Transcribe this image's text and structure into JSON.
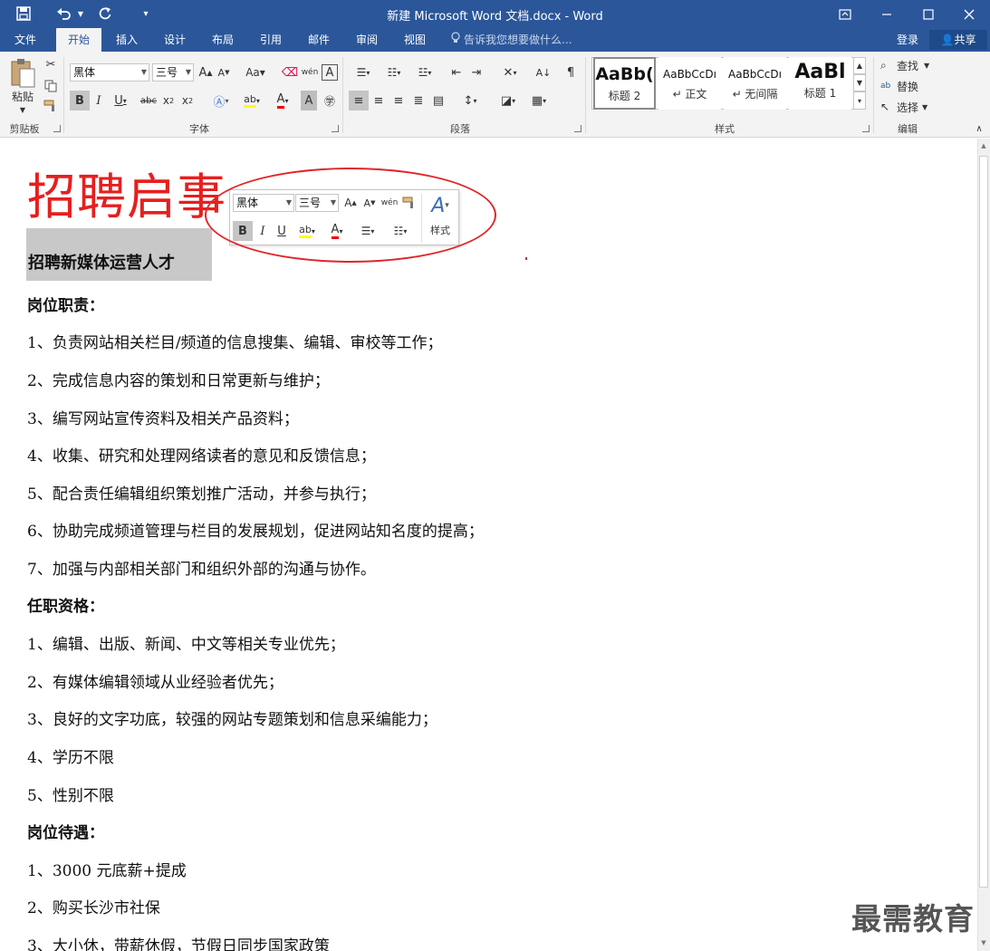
{
  "window": {
    "title": "新建 Microsoft Word 文档.docx - Word"
  },
  "quick_access": {
    "save_icon": "save-icon",
    "undo_icon": "undo-icon",
    "redo_icon": "redo-icon",
    "customize_icon": "customize-icon"
  },
  "tabs": [
    "文件",
    "开始",
    "插入",
    "设计",
    "布局",
    "引用",
    "邮件",
    "审阅",
    "视图"
  ],
  "tell_me": "告诉我您想要做什么...",
  "login": "登录",
  "share": "共享",
  "ribbon": {
    "groups": {
      "clipboard": "剪贴板",
      "font": "字体",
      "paragraph": "段落",
      "styles": "样式",
      "editing": "编辑"
    },
    "paste_label": "粘贴",
    "font_name": "黑体",
    "font_size": "三号",
    "styles": [
      {
        "preview": "AaBb(",
        "name": "标题 2"
      },
      {
        "preview": "AaBbCcDı",
        "name": "↵ 正文"
      },
      {
        "preview": "AaBbCcDı",
        "name": "↵ 无间隔"
      },
      {
        "preview": "AaBl",
        "name": "标题 1"
      }
    ],
    "find": "查找",
    "replace": "替换",
    "select": "选择"
  },
  "mini_toolbar": {
    "font_name": "黑体",
    "font_size": "三号",
    "styles_label": "样式"
  },
  "document": {
    "title": "招聘启事",
    "subtitle": "招聘新媒体运营人才",
    "lines": [
      {
        "text": "岗位职责：",
        "heading": true
      },
      {
        "text": "1、负责网站相关栏目/频道的信息搜集、编辑、审校等工作；",
        "heading": false
      },
      {
        "text": "2、完成信息内容的策划和日常更新与维护；",
        "heading": false
      },
      {
        "text": "3、编写网站宣传资料及相关产品资料；",
        "heading": false
      },
      {
        "text": "4、收集、研究和处理网络读者的意见和反馈信息；",
        "heading": false
      },
      {
        "text": "5、配合责任编辑组织策划推广活动，并参与执行；",
        "heading": false
      },
      {
        "text": "6、协助完成频道管理与栏目的发展规划，促进网站知名度的提高；",
        "heading": false
      },
      {
        "text": "7、加强与内部相关部门和组织外部的沟通与协作。",
        "heading": false
      },
      {
        "text": "任职资格：",
        "heading": true
      },
      {
        "text": "1、编辑、出版、新闻、中文等相关专业优先；",
        "heading": false
      },
      {
        "text": "2、有媒体编辑领域从业经验者优先；",
        "heading": false
      },
      {
        "text": "3、良好的文字功底，较强的网站专题策划和信息采编能力；",
        "heading": false
      },
      {
        "text": "4、学历不限",
        "heading": false
      },
      {
        "text": "5、性别不限",
        "heading": false
      },
      {
        "text": "岗位待遇：",
        "heading": true
      },
      {
        "text": "1、3000 元底薪+提成",
        "heading": false
      },
      {
        "text": "2、购买长沙市社保",
        "heading": false
      },
      {
        "text": "3、大小休，带薪休假，节假日同步国家政策",
        "heading": false
      }
    ]
  },
  "watermark": "最需教育",
  "colors": {
    "ribbon_blue": "#2b579a",
    "title_red": "#e61f1f",
    "annotation_red": "#e0262a"
  }
}
